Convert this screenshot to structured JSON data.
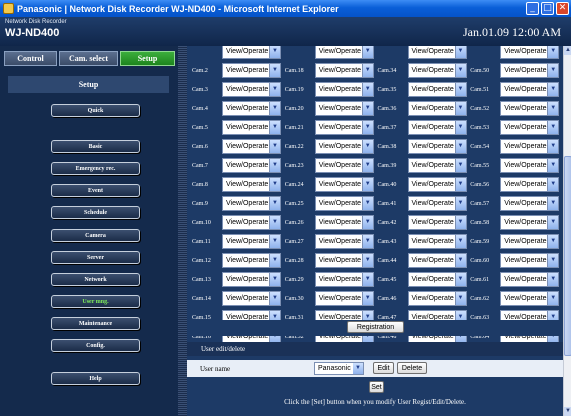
{
  "window": {
    "title": "Panasonic | Network Disk Recorder WJ-ND400 - Microsoft Internet Explorer"
  },
  "header": {
    "brand_small": "Network Disk Recorder",
    "brand_model": "WJ-ND400",
    "datetime": "Jan.01.09  12:00  AM"
  },
  "sidebar": {
    "tabs": [
      {
        "label": "Control",
        "active": false
      },
      {
        "label": "Cam. select",
        "active": false
      },
      {
        "label": "Setup",
        "active": true
      }
    ],
    "section_title": "Setup",
    "nav": [
      {
        "label": "Quick",
        "active": false
      },
      {
        "label": "Basic",
        "active": false
      },
      {
        "label": "Emergency rec.",
        "active": false
      },
      {
        "label": "Event",
        "active": false
      },
      {
        "label": "Schedule",
        "active": false
      },
      {
        "label": "Camera",
        "active": false
      },
      {
        "label": "Server",
        "active": false
      },
      {
        "label": "Network",
        "active": false
      },
      {
        "label": "User mng.",
        "active": true
      },
      {
        "label": "Maintenance",
        "active": false
      },
      {
        "label": "Config.",
        "active": false
      },
      {
        "label": "Help",
        "active": false
      }
    ]
  },
  "permissions": {
    "option_value": "View/Operate",
    "rows": [
      [
        "",
        "",
        "",
        ""
      ],
      [
        "Cam.2",
        "Cam.18",
        "Cam.34",
        "Cam.50"
      ],
      [
        "Cam.3",
        "Cam.19",
        "Cam.35",
        "Cam.51"
      ],
      [
        "Cam.4",
        "Cam.20",
        "Cam.36",
        "Cam.52"
      ],
      [
        "Cam.5",
        "Cam.21",
        "Cam.37",
        "Cam.53"
      ],
      [
        "Cam.6",
        "Cam.22",
        "Cam.38",
        "Cam.54"
      ],
      [
        "Cam.7",
        "Cam.23",
        "Cam.39",
        "Cam.55"
      ],
      [
        "Cam.8",
        "Cam.24",
        "Cam.40",
        "Cam.56"
      ],
      [
        "Cam.9",
        "Cam.25",
        "Cam.41",
        "Cam.57"
      ],
      [
        "Cam.10",
        "Cam.26",
        "Cam.42",
        "Cam.58"
      ],
      [
        "Cam.11",
        "Cam.27",
        "Cam.43",
        "Cam.59"
      ],
      [
        "Cam.12",
        "Cam.28",
        "Cam.44",
        "Cam.60"
      ],
      [
        "Cam.13",
        "Cam.29",
        "Cam.45",
        "Cam.61"
      ],
      [
        "Cam.14",
        "Cam.30",
        "Cam.46",
        "Cam.62"
      ],
      [
        "Cam.15",
        "Cam.31",
        "Cam.47",
        "Cam.63"
      ],
      [
        "Cam.16",
        "Cam.32",
        "Cam.48",
        "Cam.64"
      ]
    ],
    "registration_label": "Registration"
  },
  "user_edit": {
    "panel_title": "User edit/delete",
    "user_name_label": "User name",
    "selected_user": "Panasonic",
    "edit_label": "Edit",
    "delete_label": "Delete",
    "set_label": "Set",
    "note": "Click the [Set] button when you modify User Regist/Edit/Delete."
  },
  "colors": {
    "sidebar_bg": "#142a4c",
    "content_bg": "#1d3a66",
    "active_tab": "#2a9b2a",
    "active_nav_text": "#7dea5a"
  }
}
